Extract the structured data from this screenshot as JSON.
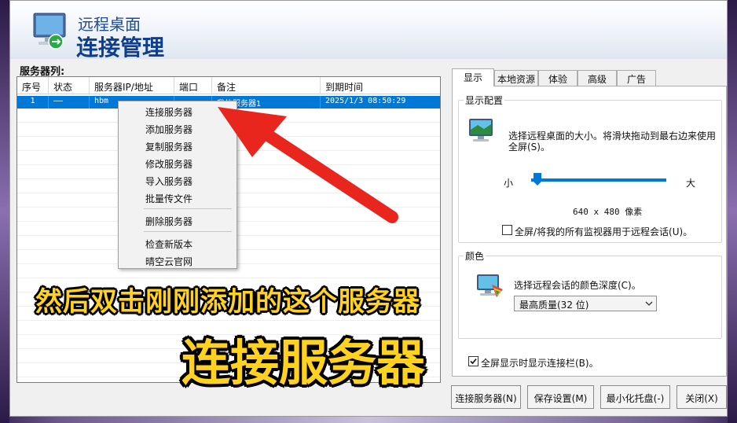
{
  "header": {
    "subtitle": "远程桌面",
    "title": "连接管理"
  },
  "server_list": {
    "label": "服务器列:",
    "columns": [
      "序号",
      "状态",
      "服务器IP/地址",
      "端口",
      "备注",
      "到期时间"
    ],
    "rows": [
      {
        "index": "1",
        "status": "——",
        "address": "hbm",
        "port": "",
        "note": "我的服务器1",
        "expiry": "2025/1/3 08:50:29"
      }
    ]
  },
  "context_menu": {
    "items": [
      "连接服务器",
      "添加服务器",
      "复制服务器",
      "修改服务器",
      "导入服务器",
      "批量传文件",
      "删除服务器",
      "检查新版本",
      "晴空云官网"
    ]
  },
  "overlay": {
    "caption_line1": "然后双击刚刚添加的这个服务器",
    "caption_line2": "连接服务器"
  },
  "tabs": [
    "显示",
    "本地资源",
    "体验",
    "高级",
    "广告"
  ],
  "display_group": {
    "title": "显示配置",
    "description": "选择远程桌面的大小。将滑块拖动到最右边来使用全屏(S)。",
    "slider_min_label": "小",
    "slider_max_label": "大",
    "slider_level": 0.0,
    "resolution": "640 x 480 像素",
    "multi_monitor_label": "全屏/将我的所有监视器用于远程会话(U)。",
    "multi_monitor_checked": false
  },
  "color_group": {
    "title": "颜色",
    "description": "选择远程会话的颜色深度(C)。",
    "selected": "最高质量(32 位)"
  },
  "fullscreen_bar": {
    "label": "全屏显示时显示连接栏(B)。",
    "checked": true
  },
  "buttons": {
    "connect": "连接服务器(N)",
    "save": "保存设置(M)",
    "minimize": "最小化托盘(-)",
    "close": "关闭(X)"
  },
  "colors": {
    "accent": "#0078d7",
    "arrow": "#e8261e",
    "caption": "#ffd21f",
    "title": "#0e3e8c"
  }
}
